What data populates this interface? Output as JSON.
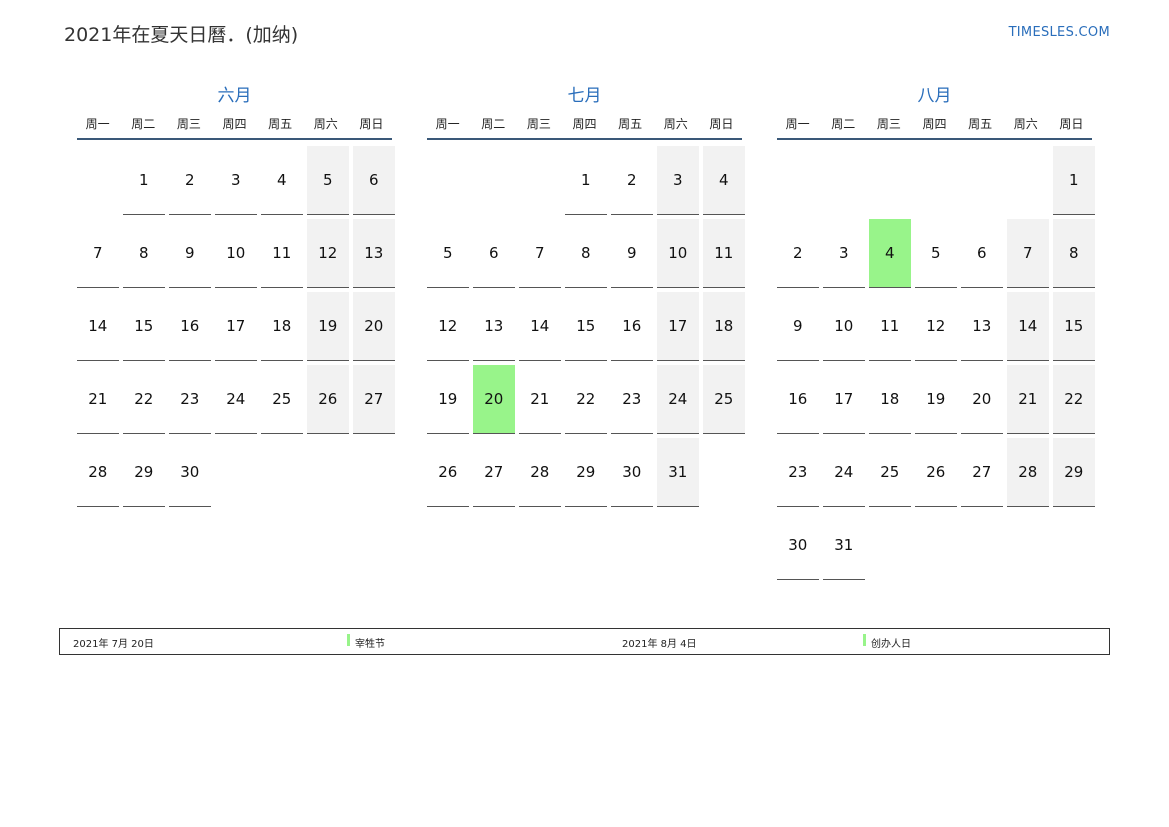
{
  "header": {
    "title": "2021年在夏天日曆．(加纳)",
    "brand": "TIMESLES.COM"
  },
  "weekdays": [
    "周一",
    "周二",
    "周三",
    "周四",
    "周五",
    "周六",
    "周日"
  ],
  "colors": {
    "accent": "#2a6ebb",
    "holiday": "#98f48a",
    "weekend": "#f2f2f2"
  },
  "months": [
    {
      "name": "六月",
      "offset": 1,
      "days": 30,
      "holidays": []
    },
    {
      "name": "七月",
      "offset": 3,
      "days": 31,
      "holidays": [
        20
      ]
    },
    {
      "name": "八月",
      "offset": 6,
      "days": 31,
      "holidays": [
        4
      ]
    }
  ],
  "legend": [
    {
      "date": "2021年 7月 20日",
      "name": "宰牲节"
    },
    {
      "date": "2021年 8月 4日",
      "name": "创办人日"
    }
  ]
}
